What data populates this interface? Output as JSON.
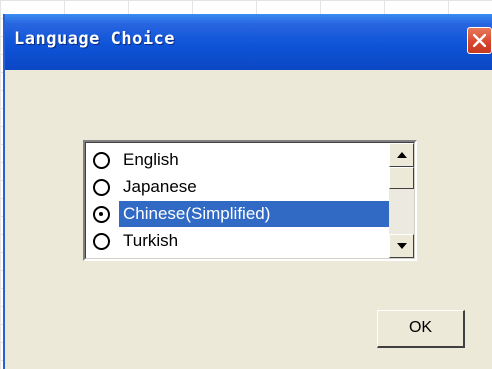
{
  "window": {
    "title": "Language Choice"
  },
  "languages": {
    "items": [
      {
        "label": "English",
        "selected": false
      },
      {
        "label": "Japanese",
        "selected": false
      },
      {
        "label": "Chinese(Simplified)",
        "selected": true
      },
      {
        "label": "Turkish",
        "selected": false
      }
    ]
  },
  "buttons": {
    "ok_label": "OK"
  },
  "icons": {
    "close": "close-icon",
    "scroll_up": "arrow-up-icon",
    "scroll_down": "arrow-down-icon"
  },
  "colors": {
    "titlebar": "#0e53d8",
    "selection": "#316ac5",
    "dialog_bg": "#ece9d8",
    "close_btn": "#d9432b"
  }
}
